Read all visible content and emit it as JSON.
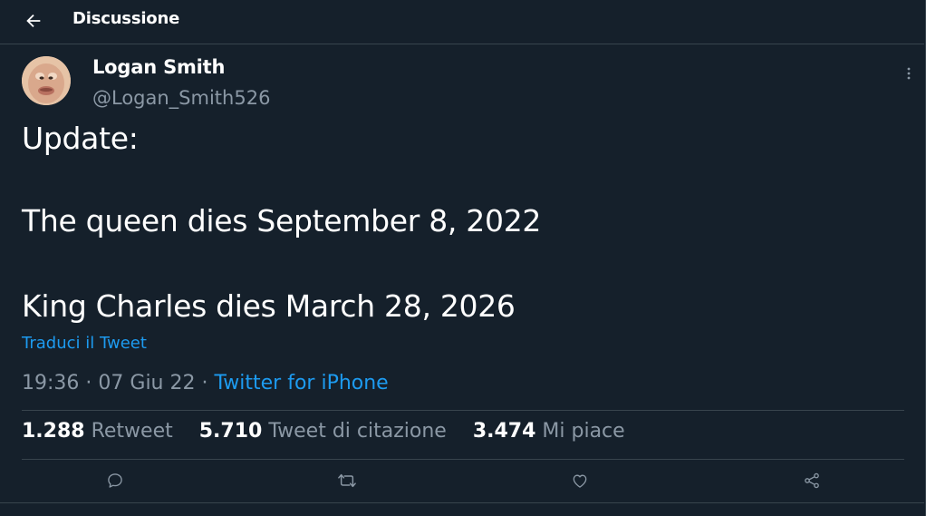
{
  "header": {
    "back_icon": "arrow-left-icon",
    "title": "Discussione"
  },
  "tweet": {
    "author": {
      "display_name": "Logan Smith",
      "handle": "@Logan_Smith526",
      "avatar_icon": "user-avatar"
    },
    "more_icon": "vertical-dots-icon",
    "lines": [
      "Update:",
      "The queen dies September 8, 2022",
      "King Charles dies March 28, 2026"
    ],
    "translate_label": "Traduci il Tweet",
    "time": "19:36",
    "date": "07 Giu 22",
    "separator": "·",
    "source": "Twitter for iPhone"
  },
  "stats": {
    "retweets": {
      "count": "1.288",
      "label": "Retweet"
    },
    "quotes": {
      "count": "5.710",
      "label": "Tweet di citazione"
    },
    "likes": {
      "count": "3.474",
      "label": "Mi piace"
    }
  },
  "actions": {
    "reply_icon": "reply-icon",
    "retweet_icon": "retweet-icon",
    "like_icon": "heart-icon",
    "share_icon": "share-icon"
  },
  "colors": {
    "background": "#15202b",
    "border": "#38444d",
    "secondary_text": "#8b98a5",
    "link": "#1d9bf0",
    "primary_text": "#ffffff"
  }
}
